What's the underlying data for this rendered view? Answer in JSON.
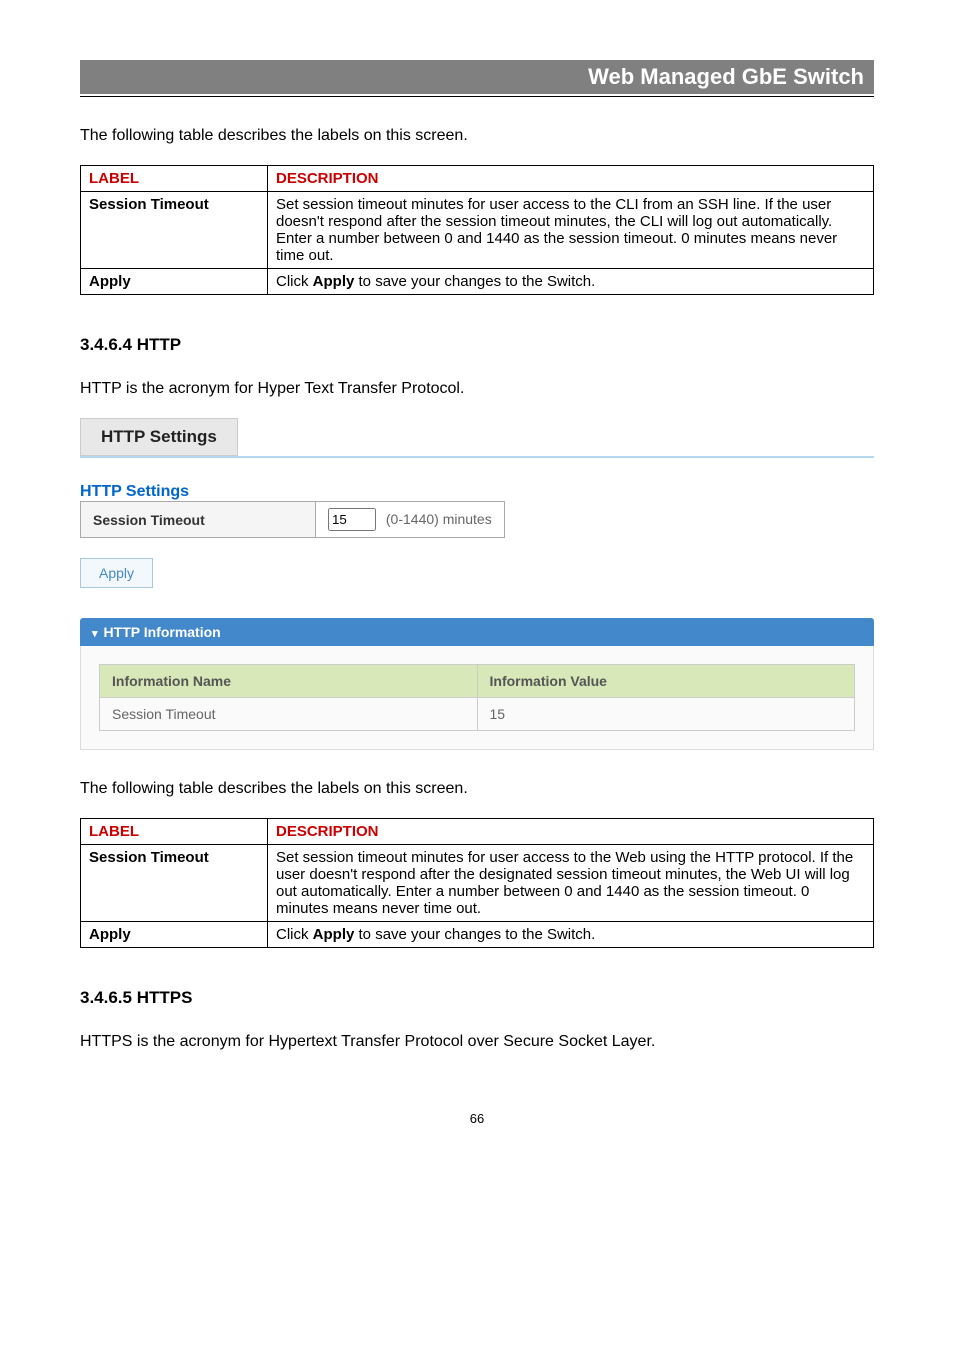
{
  "header": {
    "title": "Web Managed GbE Switch"
  },
  "intro1": "The following table describes the labels on this screen.",
  "table1": {
    "col1": "LABEL",
    "col2": "DESCRIPTION",
    "rows": [
      {
        "label": "Session Timeout",
        "desc": "Set session timeout minutes for user access to the CLI from an SSH line. If the user doesn't respond after the session timeout minutes, the CLI will log out automatically.\nEnter a number between 0 and 1440 as the session timeout. 0 minutes means never time out."
      },
      {
        "label": "Apply",
        "desc_prefix": "Click ",
        "desc_bold": "Apply",
        "desc_suffix": " to save your changes to the Switch."
      }
    ]
  },
  "sec1_heading": "3.4.6.4 HTTP",
  "sec1_intro": "HTTP is the acronym for Hyper Text Transfer Protocol.",
  "http_settings_tab": "HTTP Settings",
  "http_settings_title": "HTTP Settings",
  "settings_row_label": "Session Timeout",
  "settings_input_value": "15",
  "settings_input_suffix": "(0-1440) minutes",
  "apply_label": "Apply",
  "info_panel_title": "HTTP Information",
  "info_table": {
    "col1": "Information Name",
    "col2": "Information Value",
    "row_name": "Session Timeout",
    "row_value": "15"
  },
  "intro2": "The following table describes the labels on this screen.",
  "table2": {
    "col1": "LABEL",
    "col2": "DESCRIPTION",
    "rows": [
      {
        "label": "Session Timeout",
        "desc": "Set session timeout minutes for user access to the Web using the HTTP protocol. If the user doesn't respond after the designated session timeout minutes, the Web UI will log out automatically. Enter a number between 0 and 1440 as the session timeout. 0 minutes means never time out."
      },
      {
        "label": "Apply",
        "desc_prefix": "Click ",
        "desc_bold": "Apply",
        "desc_suffix": " to save your changes to the Switch."
      }
    ]
  },
  "sec2_heading": "3.4.6.5 HTTPS",
  "sec2_intro": "HTTPS is the acronym for Hypertext Transfer Protocol over Secure Socket Layer.",
  "page_number": "66"
}
